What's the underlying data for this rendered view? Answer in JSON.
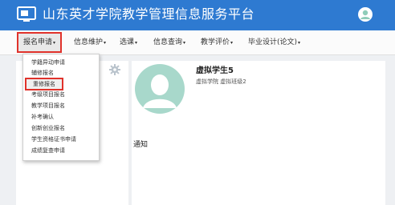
{
  "header": {
    "title": "山东英才学院教学管理信息服务平台",
    "logo_icon": "monitor-logo-icon",
    "avatar_icon": "user-avatar-icon",
    "bg_color": "#2e7ad1"
  },
  "nav": {
    "items": [
      {
        "label": "报名申请"
      },
      {
        "label": "信息维护"
      },
      {
        "label": "选课"
      },
      {
        "label": "信息查询"
      },
      {
        "label": "教学评价"
      },
      {
        "label": "毕业设计(论文)"
      }
    ],
    "caret": "▾"
  },
  "dropdown": {
    "items": [
      {
        "label": "学籍异动申请"
      },
      {
        "label": "辅修报名"
      },
      {
        "label": "重修报名"
      },
      {
        "label": "考级项目报名"
      },
      {
        "label": "教学项目报名"
      },
      {
        "label": "补考确认"
      },
      {
        "label": "创新创业报名"
      },
      {
        "label": "学生资格证书申请"
      },
      {
        "label": "成绩复查申请"
      }
    ]
  },
  "profile": {
    "name": "虚拟学生5",
    "sub": "虚拟学院 虚拟班级2"
  },
  "notice": {
    "title": "通知"
  },
  "colors": {
    "accent": "#2e7ad1",
    "highlight_border": "#e0322b",
    "avatar_bg": "#a8d8cb"
  }
}
